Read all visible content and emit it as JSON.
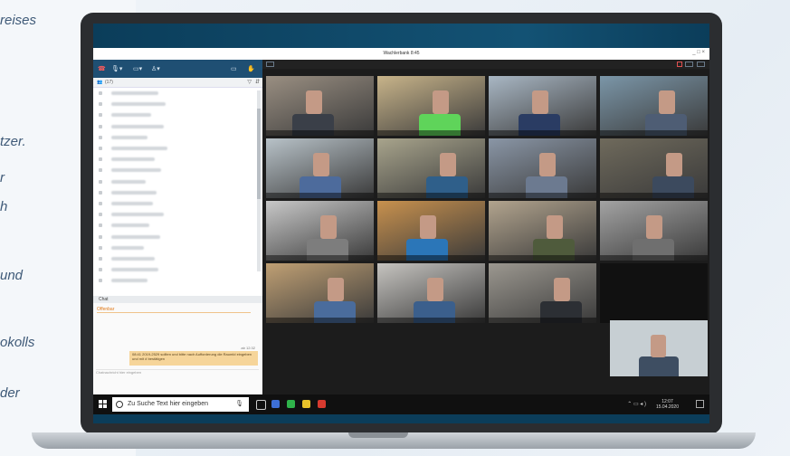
{
  "background_text": {
    "lines": [
      "reises",
      "tzer.",
      "r",
      "h",
      "und",
      "okolls",
      "der"
    ]
  },
  "window": {
    "title": "Wachlerbank 8:45",
    "controls": "_ □ ×"
  },
  "left_panel": {
    "toolbar_icons": [
      "phone-hangup-icon",
      "mic-icon",
      "camera-icon",
      "person-icon",
      "settings-icon",
      "hand-icon"
    ],
    "participants_header": "(17)",
    "participant_count": 18,
    "chat_header": "Chat",
    "chat_sender": "Offenbar",
    "chat_time": "ab 12:32",
    "chat_message": "08:41 2019-2529 sollten und bitte nach Aufforderung die Raumld eingeben und mit # bestätigen",
    "chat_input_placeholder": "Chatnachricht hier eingeben"
  },
  "video": {
    "grid_rows": 4,
    "grid_cols": 4,
    "empty_tiles": [
      15
    ],
    "tile_colors": [
      "#9a8f82",
      "#c8b48a",
      "#a9b7c4",
      "#7b96a8",
      "#b8c2c8",
      "#a8a48c",
      "#8a96a6",
      "#6f6a5c",
      "#c8c8c8",
      "#c8914e",
      "#b2a48e",
      "#a3a3a3",
      "#c0a074",
      "#c6c4c0",
      "#9c9890",
      "#111111"
    ],
    "self_view_color": "#c7cfd3"
  },
  "taskbar": {
    "search_placeholder": "Zu Suche Text hier eingeben",
    "time": "12:07",
    "date": "15.04.2020",
    "app_colors": [
      "#ffffff",
      "#3d6fd6",
      "#2fb34a",
      "#e8c22a",
      "#d73a2f"
    ]
  }
}
